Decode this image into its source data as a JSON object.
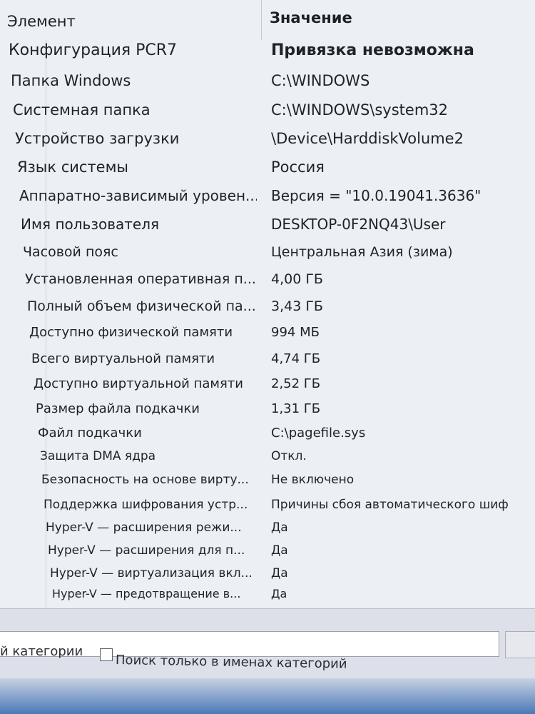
{
  "header": {
    "element": "Элемент",
    "value": "Значение"
  },
  "rows": [
    {
      "name": "Конфигурация PCR7",
      "value": "Привязка невозможна"
    },
    {
      "name": "Папка Windows",
      "value": "C:\\WINDOWS"
    },
    {
      "name": "Системная папка",
      "value": "C:\\WINDOWS\\system32"
    },
    {
      "name": "Устройство загрузки",
      "value": "\\Device\\HarddiskVolume2"
    },
    {
      "name": "Язык системы",
      "value": "Россия"
    },
    {
      "name": "Аппаратно-зависимый уровен...",
      "value": "Версия = \"10.0.19041.3636\""
    },
    {
      "name": "Имя пользователя",
      "value": "DESKTOP-0F2NQ43\\User"
    },
    {
      "name": "Часовой пояс",
      "value": "Центральная Азия (зима)"
    },
    {
      "name": "Установленная оперативная п...",
      "value": "4,00 ГБ"
    },
    {
      "name": "Полный объем физической па...",
      "value": "3,43 ГБ"
    },
    {
      "name": "Доступно физической памяти",
      "value": "994 МБ"
    },
    {
      "name": "Всего виртуальной памяти",
      "value": "4,74 ГБ"
    },
    {
      "name": "Доступно виртуальной памяти",
      "value": "2,52 ГБ"
    },
    {
      "name": "Размер файла подкачки",
      "value": "1,31 ГБ"
    },
    {
      "name": "Файл подкачки",
      "value": "C:\\pagefile.sys"
    },
    {
      "name": "Защита DMA ядра",
      "value": "Откл."
    },
    {
      "name": "Безопасность на основе вирту...",
      "value": "Не включено"
    },
    {
      "name": "Поддержка шифрования устр...",
      "value": "Причины сбоя автоматического шиф"
    },
    {
      "name": "Hyper-V — расширения режи...",
      "value": "Да"
    },
    {
      "name": "Hyper-V — расширения для п...",
      "value": "Да"
    },
    {
      "name": "Hyper-V — виртуализация вкл...",
      "value": "Да"
    },
    {
      "name": "Hyper-V — предотвращение в...",
      "value": "Да"
    }
  ],
  "search": {
    "option1_label": "й категории",
    "option2_label": "Поиск только в именах категорий"
  }
}
